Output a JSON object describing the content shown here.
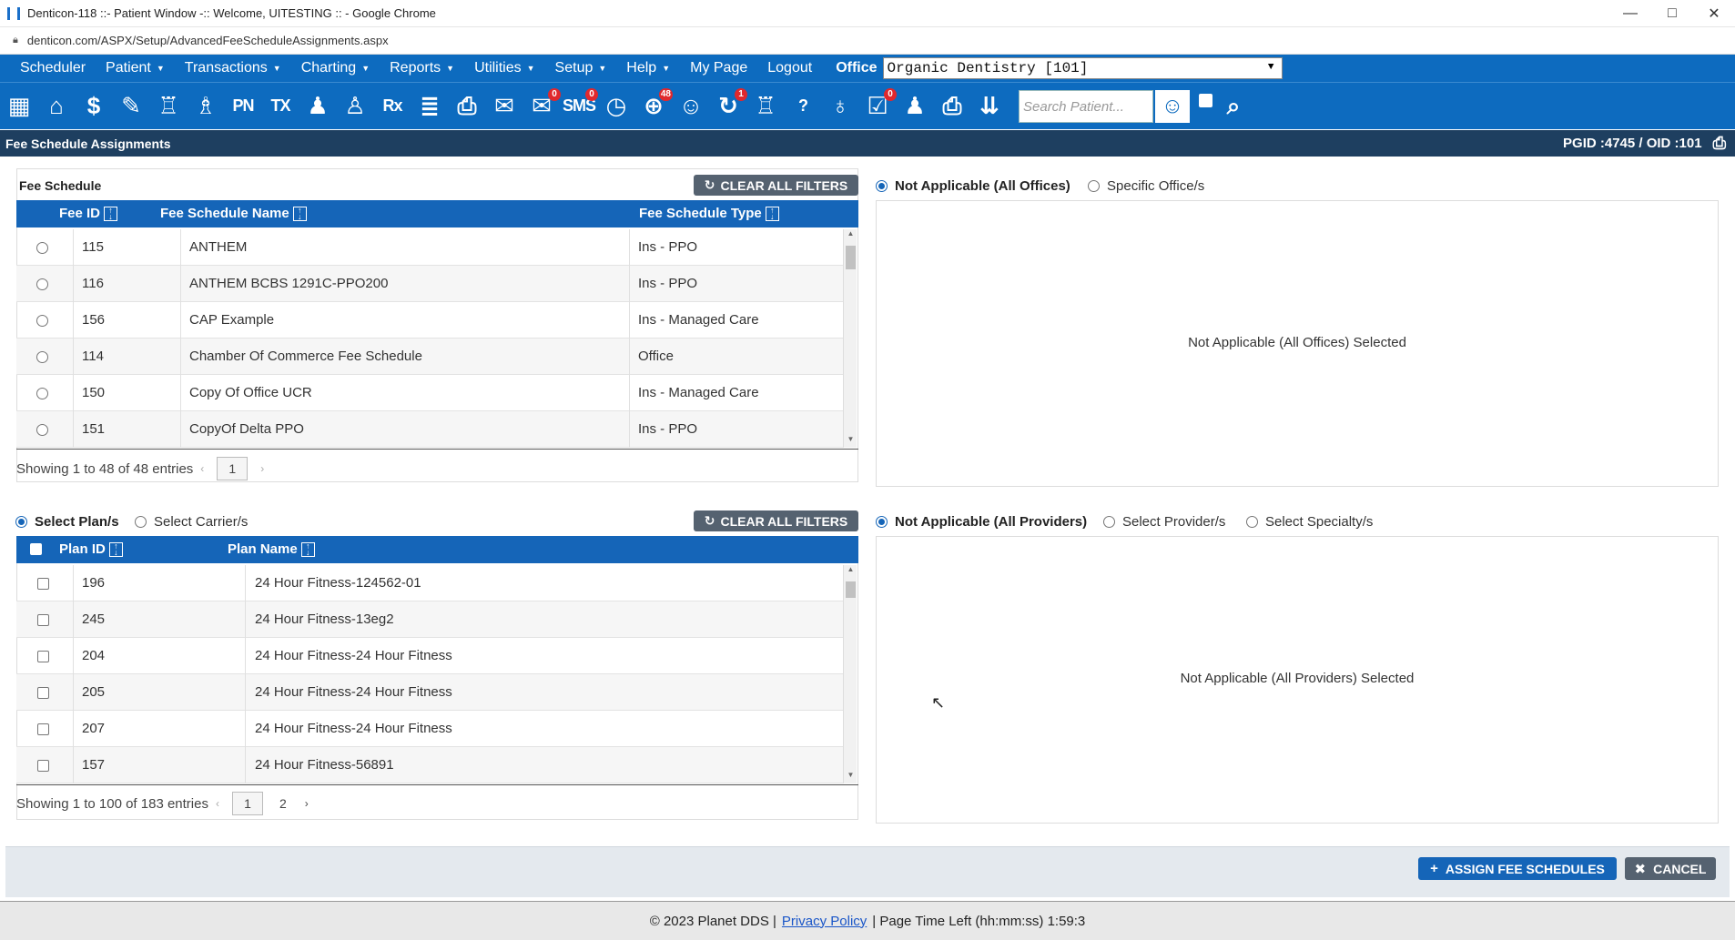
{
  "browser": {
    "title": "Denticon-118 ::- Patient Window -:: Welcome, UITESTING :: - Google Chrome",
    "url": "denticon.com/ASPX/Setup/AdvancedFeeScheduleAssignments.aspx",
    "controls": [
      "—",
      "□",
      "✕"
    ]
  },
  "menu": {
    "items": [
      {
        "label": "Scheduler",
        "caret": false
      },
      {
        "label": "Patient",
        "caret": true
      },
      {
        "label": "Transactions",
        "caret": true
      },
      {
        "label": "Charting",
        "caret": true
      },
      {
        "label": "Reports",
        "caret": true
      },
      {
        "label": "Utilities",
        "caret": true
      },
      {
        "label": "Setup",
        "caret": true
      },
      {
        "label": "Help",
        "caret": true
      },
      {
        "label": "My Page",
        "caret": false
      },
      {
        "label": "Logout",
        "caret": false
      }
    ],
    "office_label": "Office",
    "office_value": "Organic Dentistry [101]"
  },
  "toolbar": {
    "icons": [
      {
        "name": "calendar-icon",
        "glyph": "▦",
        "badge": ""
      },
      {
        "name": "home-icon",
        "glyph": "⌂",
        "badge": ""
      },
      {
        "name": "dollar-icon",
        "glyph": "$",
        "badge": ""
      },
      {
        "name": "edit-notes-icon",
        "glyph": "✎",
        "badge": ""
      },
      {
        "name": "tooth-chart-icon",
        "glyph": "♖",
        "badge": ""
      },
      {
        "name": "perio-icon",
        "glyph": "♗",
        "badge": ""
      },
      {
        "name": "progress-notes-icon",
        "text": "PN",
        "badge": ""
      },
      {
        "name": "treatment-icon",
        "text": "TX",
        "badge": ""
      },
      {
        "name": "add-patient-icon",
        "glyph": "♟",
        "badge": ""
      },
      {
        "name": "family-icon",
        "glyph": "♙",
        "badge": ""
      },
      {
        "name": "prescription-icon",
        "text": "Rx",
        "badge": ""
      },
      {
        "name": "notes-icon",
        "glyph": "≣",
        "badge": ""
      },
      {
        "name": "documents-icon",
        "glyph": "⎙",
        "badge": ""
      },
      {
        "name": "mail-icon",
        "glyph": "✉",
        "badge": ""
      },
      {
        "name": "messages-icon",
        "glyph": "✉",
        "badge": "0"
      },
      {
        "name": "sms-icon",
        "text": "SMS",
        "badge": "0"
      },
      {
        "name": "clock-icon",
        "glyph": "◷",
        "badge": ""
      },
      {
        "name": "online-icon",
        "glyph": "⊕",
        "badge": "48"
      },
      {
        "name": "support-icon",
        "glyph": "☺",
        "badge": ""
      },
      {
        "name": "alerts-icon",
        "glyph": "↻",
        "badge": "1"
      },
      {
        "name": "tooth-icon",
        "glyph": "♖",
        "badge": ""
      },
      {
        "name": "help-tooth-icon",
        "text": "?",
        "badge": ""
      },
      {
        "name": "globe-icon",
        "glyph": "♁",
        "badge": ""
      },
      {
        "name": "tasks-icon",
        "glyph": "☑",
        "badge": "0"
      },
      {
        "name": "group-icon",
        "glyph": "♟",
        "badge": ""
      },
      {
        "name": "printer-icon",
        "glyph": "⎙",
        "badge": ""
      },
      {
        "name": "download-icon",
        "glyph": "⇊",
        "badge": ""
      }
    ],
    "search_placeholder": "Search Patient..."
  },
  "page": {
    "title": "Fee Schedule Assignments",
    "ids": "PGID :4745  /  OID :101"
  },
  "fee_schedule": {
    "title": "Fee Schedule",
    "clear_label": "CLEAR ALL FILTERS",
    "columns": [
      "Fee ID",
      "Fee Schedule Name",
      "Fee Schedule Type"
    ],
    "rows": [
      {
        "id": "115",
        "name": "ANTHEM",
        "type": "Ins - PPO"
      },
      {
        "id": "116",
        "name": "ANTHEM BCBS 1291C-PPO200",
        "type": "Ins - PPO"
      },
      {
        "id": "156",
        "name": "CAP Example",
        "type": "Ins - Managed Care"
      },
      {
        "id": "114",
        "name": "Chamber Of Commerce Fee Schedule",
        "type": "Office"
      },
      {
        "id": "150",
        "name": "Copy Of Office UCR",
        "type": "Ins - Managed Care"
      },
      {
        "id": "151",
        "name": "CopyOf Delta PPO",
        "type": "Ins - PPO"
      }
    ],
    "showing": "Showing 1 to 48 of 48 entries",
    "page": "1"
  },
  "offices": {
    "option_na": "Not Applicable (All Offices)",
    "option_specific": "Specific Office/s",
    "selected_msg": "Not Applicable (All Offices) Selected"
  },
  "plans": {
    "option_plans": "Select Plan/s",
    "option_carriers": "Select Carrier/s",
    "clear_label": "CLEAR ALL FILTERS",
    "columns": [
      "Plan ID",
      "Plan Name"
    ],
    "rows": [
      {
        "id": "196",
        "name": "24 Hour Fitness-124562-01"
      },
      {
        "id": "245",
        "name": "24 Hour Fitness-13eg2"
      },
      {
        "id": "204",
        "name": "24 Hour Fitness-24 Hour Fitness"
      },
      {
        "id": "205",
        "name": "24 Hour Fitness-24 Hour Fitness"
      },
      {
        "id": "207",
        "name": "24 Hour Fitness-24 Hour Fitness"
      },
      {
        "id": "157",
        "name": "24 Hour Fitness-56891"
      }
    ],
    "showing": "Showing 1 to 100 of 183 entries",
    "pages": [
      "1",
      "2"
    ]
  },
  "providers": {
    "option_na": "Not Applicable (All Providers)",
    "option_providers": "Select Provider/s",
    "option_specialty": "Select Specialty/s",
    "selected_msg": "Not Applicable (All Providers) Selected"
  },
  "actions": {
    "assign_label": "ASSIGN FEE SCHEDULES",
    "cancel_label": "CANCEL"
  },
  "footer": {
    "copyright": "© 2023 Planet DDS |",
    "privacy": "Privacy Policy",
    "time_left": "| Page Time Left (hh:mm:ss) 1:59:3"
  },
  "colors": {
    "nav_blue": "#0d6bbf",
    "grid_header": "#1565b8",
    "page_header": "#1e3f60",
    "assign_button": "#1565b8",
    "cancel_button": "#556270"
  }
}
